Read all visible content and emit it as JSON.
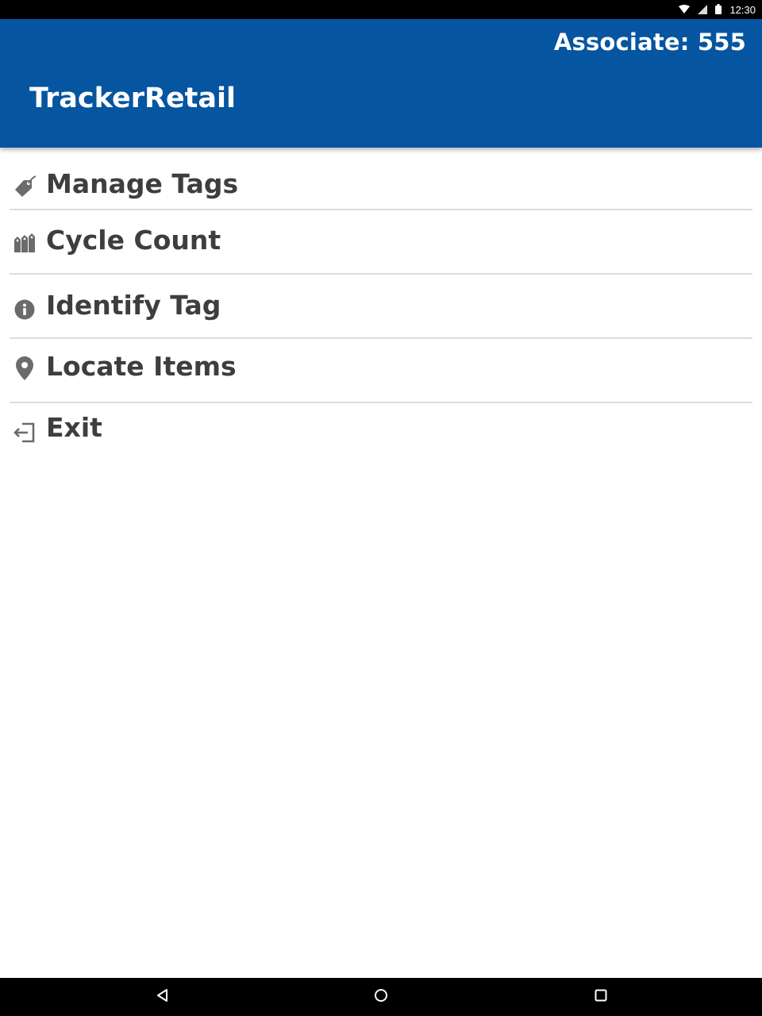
{
  "status_bar": {
    "time": "12:30",
    "icons": [
      "wifi-icon",
      "cell-signal-icon",
      "battery-icon"
    ]
  },
  "header": {
    "associate_label": "Associate: 555",
    "app_title": "TrackerRetail",
    "background_color": "#0655a0"
  },
  "menu": {
    "items": [
      {
        "label": "Manage Tags",
        "icon": "tag-icon"
      },
      {
        "label": "Cycle Count",
        "icon": "tags-multiple-icon"
      },
      {
        "label": "Identify Tag",
        "icon": "info-icon"
      },
      {
        "label": "Locate Items",
        "icon": "map-pin-icon"
      },
      {
        "label": "Exit",
        "icon": "sign-out-icon"
      }
    ],
    "text_color": "#3e3e3e",
    "icon_color": "#6b6b6b"
  },
  "nav_bar": {
    "buttons": [
      "back-icon",
      "home-icon",
      "recents-icon"
    ]
  }
}
